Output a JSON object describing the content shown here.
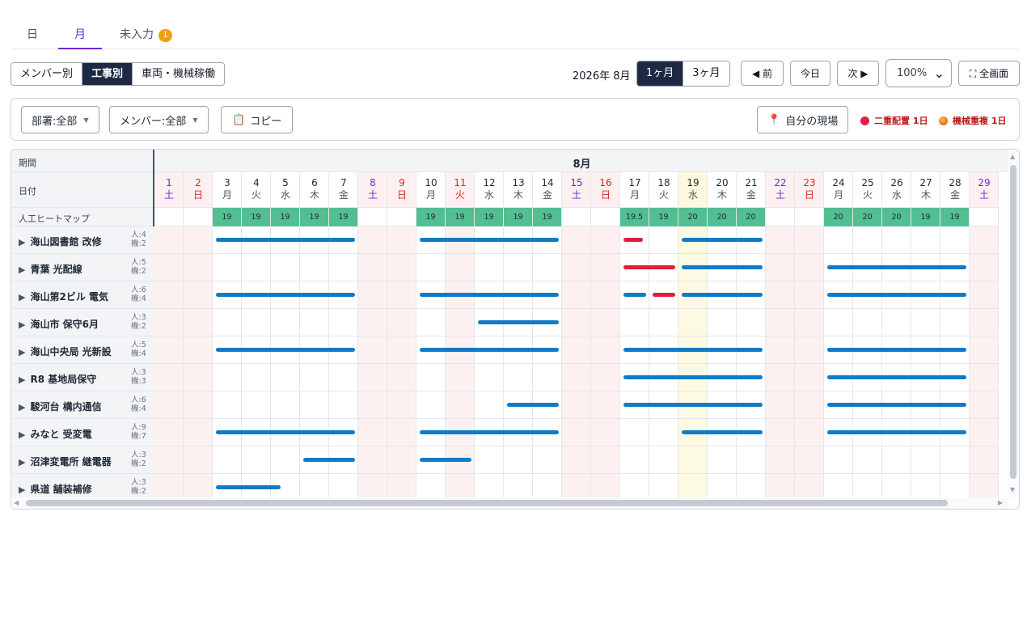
{
  "tabs": [
    {
      "label": "日"
    },
    {
      "label": "月"
    },
    {
      "label": "未入力",
      "badge": "1"
    }
  ],
  "view_modes": [
    "メンバー別",
    "工事別",
    "車両・機械稼働"
  ],
  "selected_view": "工事別",
  "period_label": "2026年 8月",
  "range_options": [
    "1ヶ月",
    "3ヶ月"
  ],
  "selected_range": "1ヶ月",
  "nav": {
    "prev": "◀ 前",
    "today": "今日",
    "next": "次 ▶"
  },
  "zoom": "100%",
  "fullscreen": "⛶ 全画面",
  "filters": {
    "department": "部署:全部",
    "member": "メンバー:全部",
    "copy": "コピー"
  },
  "my_site": "自分の現場",
  "legend": [
    {
      "label": "二重配置 1日",
      "color": "#e11d48"
    },
    {
      "label": "機械重複 1日",
      "color": "#f97316"
    }
  ],
  "grid": {
    "period_label": "期間",
    "date_label": "日付",
    "heatmap_label": "人工ヒートマップ",
    "month": "8月",
    "today_day": 19,
    "days": [
      {
        "d": "1",
        "w": "土"
      },
      {
        "d": "2",
        "w": "日"
      },
      {
        "d": "3",
        "w": "月"
      },
      {
        "d": "4",
        "w": "火"
      },
      {
        "d": "5",
        "w": "水"
      },
      {
        "d": "6",
        "w": "木"
      },
      {
        "d": "7",
        "w": "金"
      },
      {
        "d": "8",
        "w": "土"
      },
      {
        "d": "9",
        "w": "日"
      },
      {
        "d": "10",
        "w": "月"
      },
      {
        "d": "11",
        "w": "火"
      },
      {
        "d": "12",
        "w": "水"
      },
      {
        "d": "13",
        "w": "木"
      },
      {
        "d": "14",
        "w": "金"
      },
      {
        "d": "15",
        "w": "土"
      },
      {
        "d": "16",
        "w": "日"
      },
      {
        "d": "17",
        "w": "月"
      },
      {
        "d": "18",
        "w": "火"
      },
      {
        "d": "19",
        "w": "水"
      },
      {
        "d": "20",
        "w": "木"
      },
      {
        "d": "21",
        "w": "金"
      },
      {
        "d": "22",
        "w": "土"
      },
      {
        "d": "23",
        "w": "日"
      },
      {
        "d": "24",
        "w": "月"
      },
      {
        "d": "25",
        "w": "火"
      },
      {
        "d": "26",
        "w": "水"
      },
      {
        "d": "27",
        "w": "木"
      },
      {
        "d": "28",
        "w": "金"
      },
      {
        "d": "29",
        "w": "土"
      }
    ],
    "holidays": [
      11
    ],
    "heatmap": {
      "3": "19",
      "4": "19",
      "5": "19",
      "6": "19",
      "7": "19",
      "10": "19",
      "11": "19",
      "12": "19",
      "13": "19",
      "14": "19",
      "17": "19.5",
      "18": "19",
      "19": "20",
      "20": "20",
      "21": "20",
      "24": "20",
      "25": "20",
      "26": "20",
      "27": "19",
      "28": "19"
    },
    "projects": [
      {
        "name": "海山図書館 改修",
        "people": "人:4",
        "machines": "機:2",
        "bars": [
          {
            "s": 3,
            "e": 7
          },
          {
            "s": 10,
            "e": 14
          },
          {
            "s": 17,
            "e": 17,
            "red": true,
            "part": 0.85
          },
          {
            "s": 19,
            "e": 21
          }
        ]
      },
      {
        "name": "青葉 光配線",
        "people": "人:5",
        "machines": "機:2",
        "bars": [
          {
            "s": 17,
            "e": 18,
            "red": true
          },
          {
            "s": 19,
            "e": 21
          },
          {
            "s": 24,
            "e": 28
          }
        ]
      },
      {
        "name": "海山第2ビル 電気",
        "people": "人:6",
        "machines": "機:4",
        "bars": [
          {
            "s": 3,
            "e": 7
          },
          {
            "s": 10,
            "e": 14
          },
          {
            "s": 17,
            "e": 17
          },
          {
            "s": 18,
            "e": 18,
            "red": true
          },
          {
            "s": 19,
            "e": 21
          },
          {
            "s": 24,
            "e": 28
          }
        ]
      },
      {
        "name": "海山市 保守6月",
        "people": "人:3",
        "machines": "機:2",
        "bars": [
          {
            "s": 12,
            "e": 14
          }
        ]
      },
      {
        "name": "海山中央局 光新設",
        "people": "人:5",
        "machines": "機:4",
        "bars": [
          {
            "s": 3,
            "e": 7
          },
          {
            "s": 10,
            "e": 14
          },
          {
            "s": 17,
            "e": 21
          },
          {
            "s": 24,
            "e": 28
          }
        ]
      },
      {
        "name": "R8 基地局保守",
        "people": "人:3",
        "machines": "機:3",
        "bars": [
          {
            "s": 17,
            "e": 21
          },
          {
            "s": 24,
            "e": 28
          }
        ]
      },
      {
        "name": "駿河台 構内通信",
        "people": "人:6",
        "machines": "機:4",
        "bars": [
          {
            "s": 13,
            "e": 14
          },
          {
            "s": 17,
            "e": 21
          },
          {
            "s": 24,
            "e": 28
          }
        ]
      },
      {
        "name": "みなと 受変電",
        "people": "人:9",
        "machines": "機:7",
        "bars": [
          {
            "s": 3,
            "e": 7
          },
          {
            "s": 10,
            "e": 14
          },
          {
            "s": 19,
            "e": 21
          },
          {
            "s": 24,
            "e": 28
          }
        ]
      },
      {
        "name": "沼津変電所 継電器",
        "people": "人:3",
        "machines": "機:2",
        "bars": [
          {
            "s": 6,
            "e": 7
          },
          {
            "s": 10,
            "e": 11
          }
        ]
      },
      {
        "name": "県道 舗装補修",
        "people": "人:3",
        "machines": "機:2",
        "bars": [
          {
            "s": 3,
            "e": 5,
            "part": 0.8
          }
        ]
      }
    ]
  }
}
